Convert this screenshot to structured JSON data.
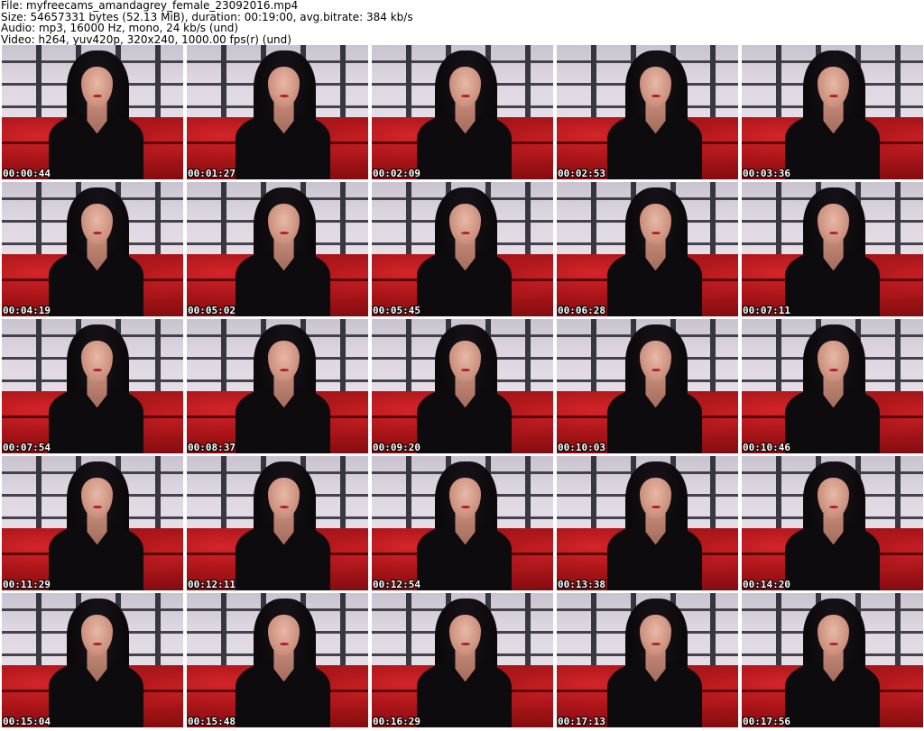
{
  "meta": {
    "file": "File: myfreecams_amandagrey_female_23092016.mp4",
    "size": "Size: 54657331 bytes (52.13 MiB), duration: 00:19:00, avg.bitrate: 384 kb/s",
    "audio": "Audio: mp3, 16000 Hz, mono, 24 kb/s (und)",
    "video": "Video: h264, yuv420p, 320x240, 1000.00 fps(r) (und)"
  },
  "thumbnails": [
    {
      "time": "00:00:44"
    },
    {
      "time": "00:01:27"
    },
    {
      "time": "00:02:09"
    },
    {
      "time": "00:02:53"
    },
    {
      "time": "00:03:36"
    },
    {
      "time": "00:04:19"
    },
    {
      "time": "00:05:02"
    },
    {
      "time": "00:05:45"
    },
    {
      "time": "00:06:28"
    },
    {
      "time": "00:07:11"
    },
    {
      "time": "00:07:54"
    },
    {
      "time": "00:08:37"
    },
    {
      "time": "00:09:20"
    },
    {
      "time": "00:10:03"
    },
    {
      "time": "00:10:46"
    },
    {
      "time": "00:11:29"
    },
    {
      "time": "00:12:11"
    },
    {
      "time": "00:12:54"
    },
    {
      "time": "00:13:38"
    },
    {
      "time": "00:14:20"
    },
    {
      "time": "00:15:04"
    },
    {
      "time": "00:15:48"
    },
    {
      "time": "00:16:29"
    },
    {
      "time": "00:17:13"
    },
    {
      "time": "00:17:56"
    }
  ],
  "colors": {
    "background": "#ffffff",
    "sofa": "#b5161b",
    "wall": "#ddd6e0",
    "timestamp": "#ffffff"
  }
}
